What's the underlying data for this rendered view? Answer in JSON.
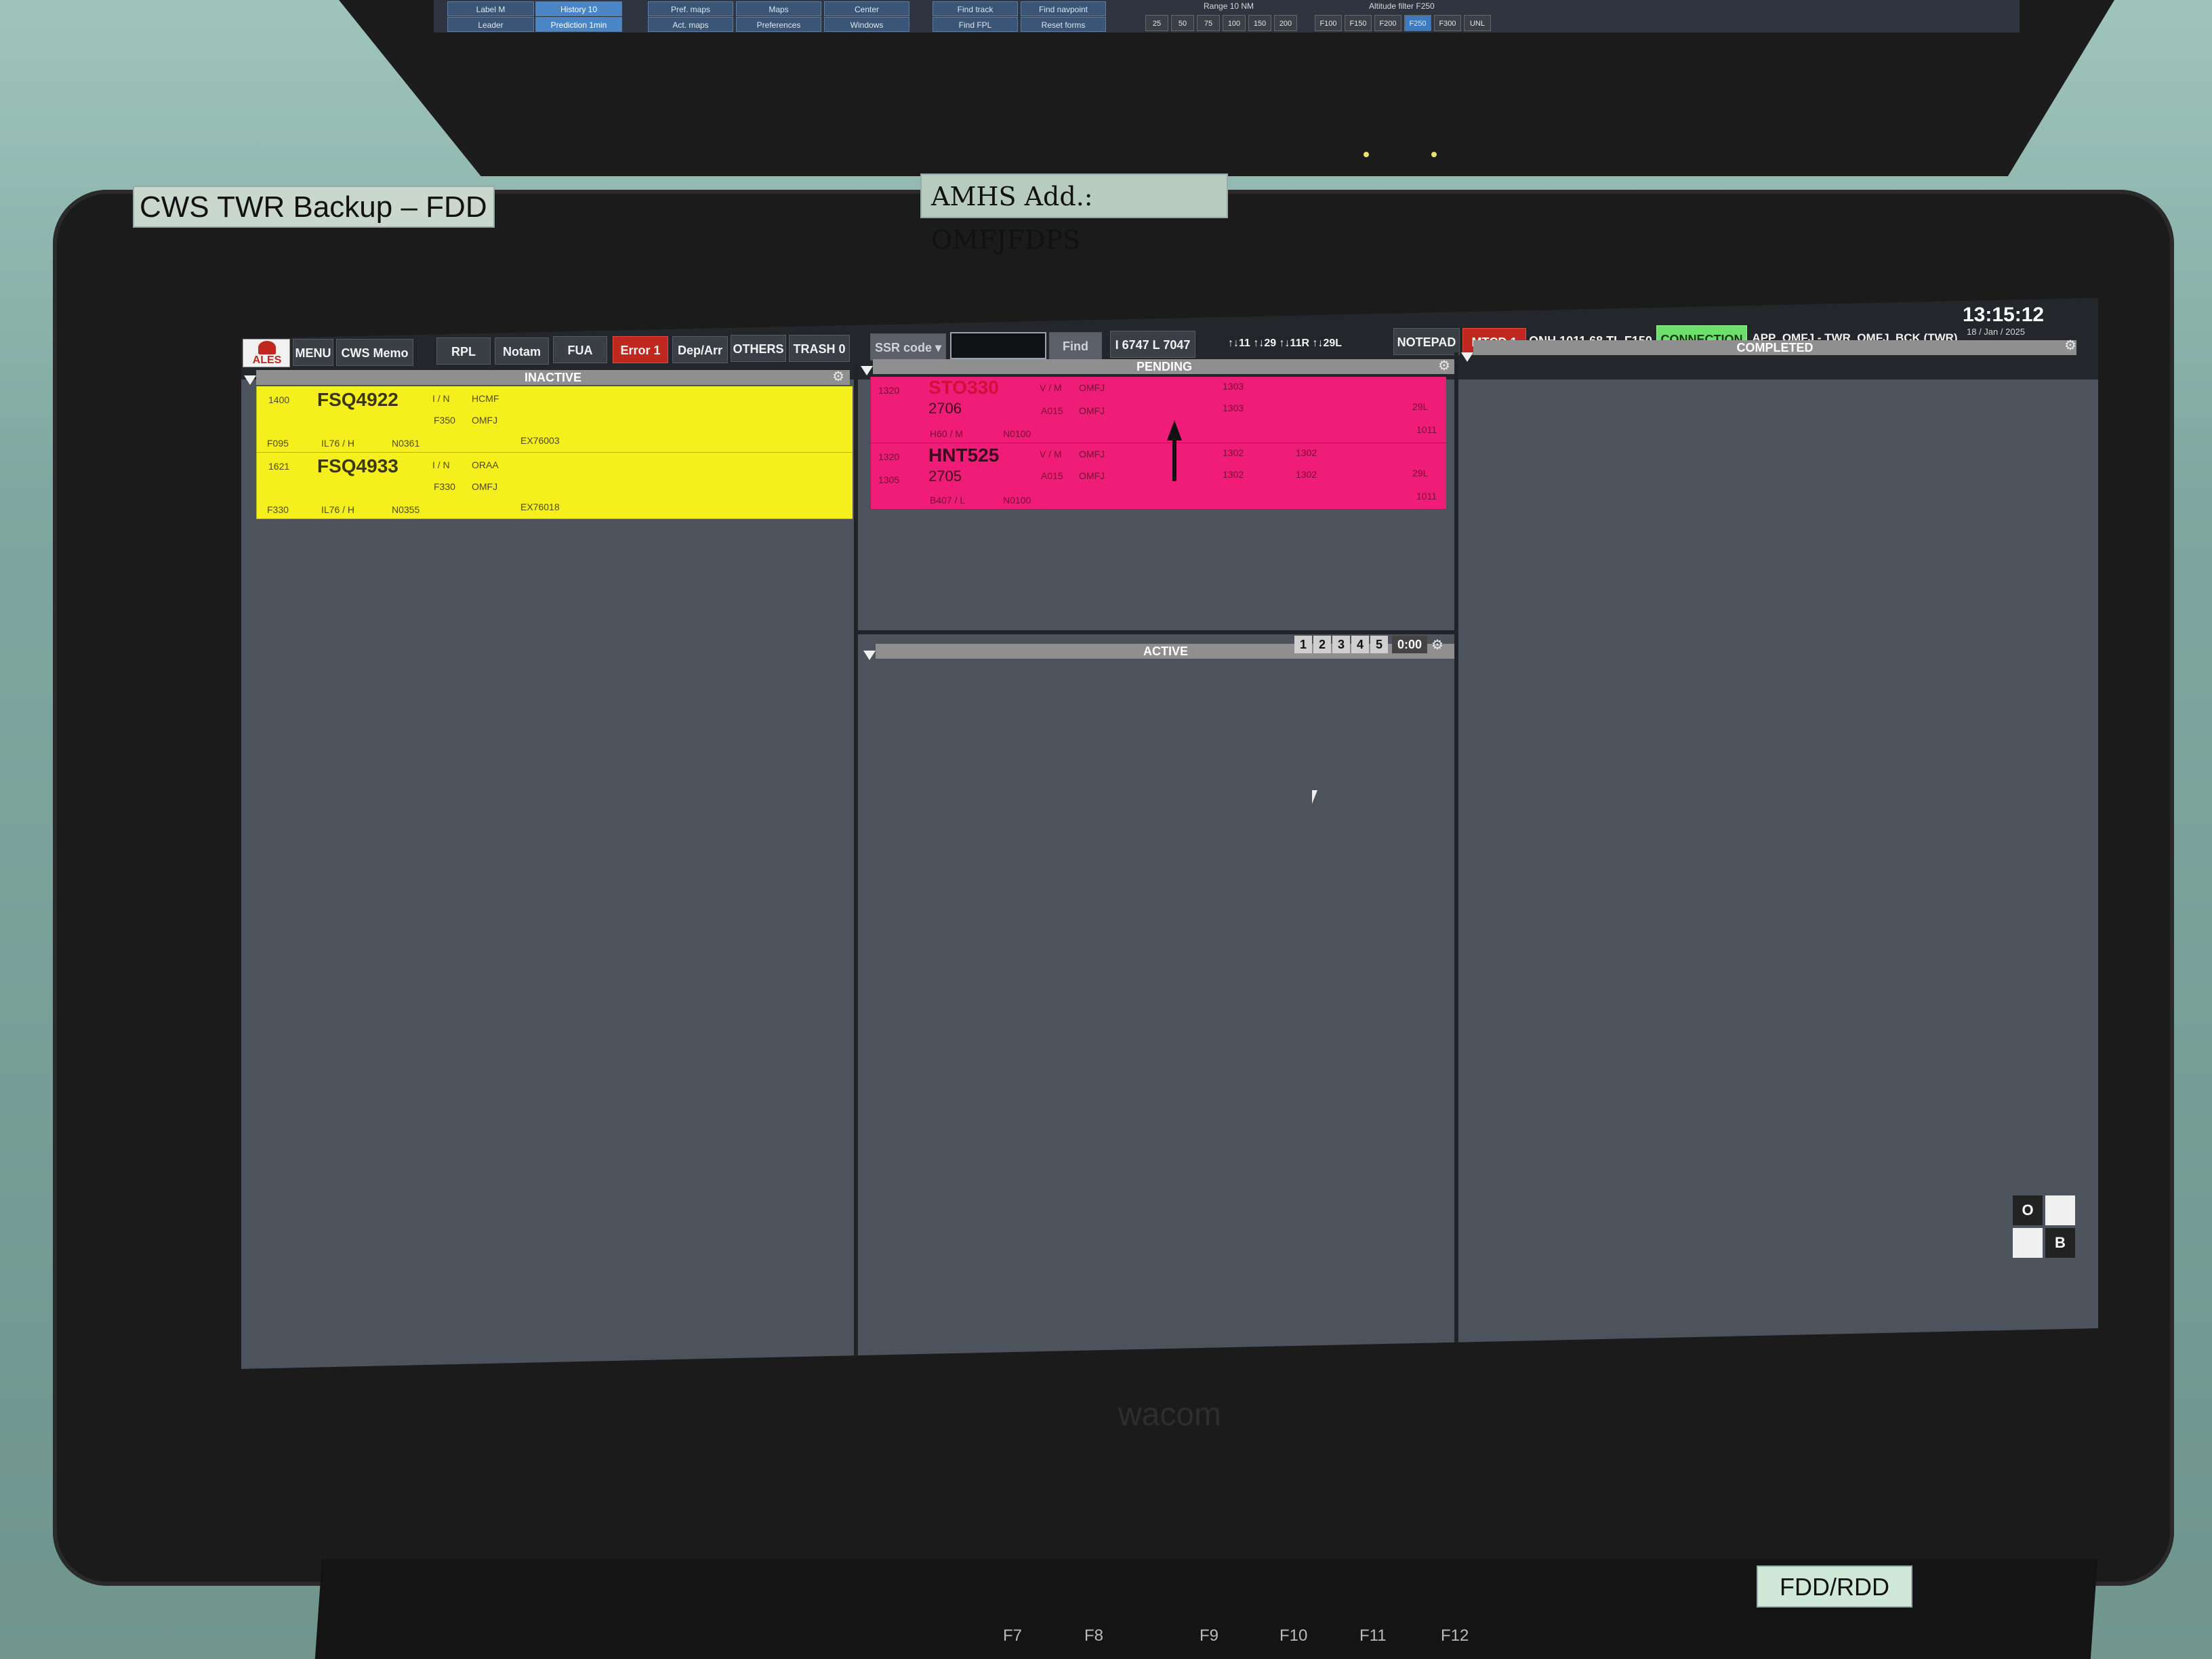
{
  "upper_monitor": {
    "buttons_row1": [
      "Label M",
      "History 10",
      "Pref. maps",
      "Maps",
      "Center",
      "Find track",
      "Find navpoint"
    ],
    "buttons_row2": [
      "Leader",
      "Prediction 1min",
      "Act. maps",
      "Preferences",
      "Windows",
      "Find FPL",
      "Reset forms"
    ],
    "range_caption": "Range 10 NM",
    "range_values": [
      "25",
      "50",
      "75",
      "100",
      "150",
      "200"
    ],
    "altitude_caption": "Altitude filter F250",
    "altitude_values": [
      "F100",
      "F150",
      "F200",
      "F250",
      "F300",
      "UNL"
    ]
  },
  "stickers": {
    "cws": "CWS TWR Backup – FDD",
    "amhs": "AMHS Add.: OMFJFDPS",
    "fdd": "FDD/RDD"
  },
  "keyboard_keys": [
    "F7",
    "F8",
    "F9",
    "F10",
    "F11",
    "F12"
  ],
  "bezel_brand": "wacom",
  "toolbar": {
    "logo": "ALES",
    "menu": "MENU",
    "cws_memo": "CWS Memo",
    "rpl": "RPL",
    "notam": "Notam",
    "fua": "FUA",
    "error": "Error 1",
    "dep_arr": "Dep/Arr",
    "others": "OTHERS",
    "trash": "TRASH 0",
    "ssr_code": "SSR code ▾",
    "ssr_input": "",
    "find": "Find",
    "counts": "I 6747 L 7047",
    "runways": "↑↓11 ↑↓29 ↑↓11R ↑↓29L",
    "notepad": "NOTEPAD",
    "mtcd": "MTCD 1",
    "qnh": "QNH 1011.68 TL F150",
    "connection": "CONNECTION",
    "position": "APP_OMFJ - TWR_OMFJ_BCK (TWR)",
    "clock": "13:15:12",
    "date": "18 / Jan / 2025"
  },
  "panels": {
    "inactive": "INACTIVE",
    "pending": "PENDING",
    "active": "ACTIVE",
    "completed": "COMPLETED",
    "active_pages": [
      "1",
      "2",
      "3",
      "4",
      "5"
    ],
    "active_timer": "0:00"
  },
  "inactive_strips": [
    {
      "time": "1400",
      "callsign": "FSQ4922",
      "rules": "I / N",
      "dest": "HCMF",
      "level1": "F350",
      "adep": "OMFJ",
      "rfl": "F095",
      "type": "IL76 / H",
      "speed": "N0361",
      "reg": "EX76003"
    },
    {
      "time": "1621",
      "callsign": "FSQ4933",
      "rules": "I / N",
      "dest": "ORAA",
      "level1": "F330",
      "adep": "OMFJ",
      "rfl": "F330",
      "type": "IL76 / H",
      "speed": "N0355",
      "reg": "EX76018"
    }
  ],
  "pending_strips": [
    {
      "time": "1320",
      "callsign": "STO330",
      "ssr": "2706",
      "rules": "V / M",
      "adep": "OMFJ",
      "alt": "A015",
      "ades": "OMFJ",
      "type": "H60 / M",
      "speed": "N0100",
      "t1": "1303",
      "t2": "1303",
      "rwy": "29L",
      "qnh": "1011",
      "time2": ""
    },
    {
      "time": "1320",
      "callsign": "HNT525",
      "ssr": "2705",
      "rules": "V / M",
      "adep": "OMFJ",
      "alt": "A015",
      "ades": "OMFJ",
      "type": "B407 / L",
      "speed": "N0100",
      "t1": "1302",
      "t2": "1302",
      "t3": "1302",
      "t4": "1302",
      "rwy": "29L",
      "qnh": "1011",
      "time2": "1305"
    }
  ],
  "corner_widget": {
    "o": "O",
    "b": "B"
  },
  "colors": {
    "inactive_strip": "#f6ef1e",
    "pending_strip": "#ef1d78",
    "error_button": "#c0281f",
    "connection_button": "#6de06b",
    "background": "#4d535c"
  }
}
